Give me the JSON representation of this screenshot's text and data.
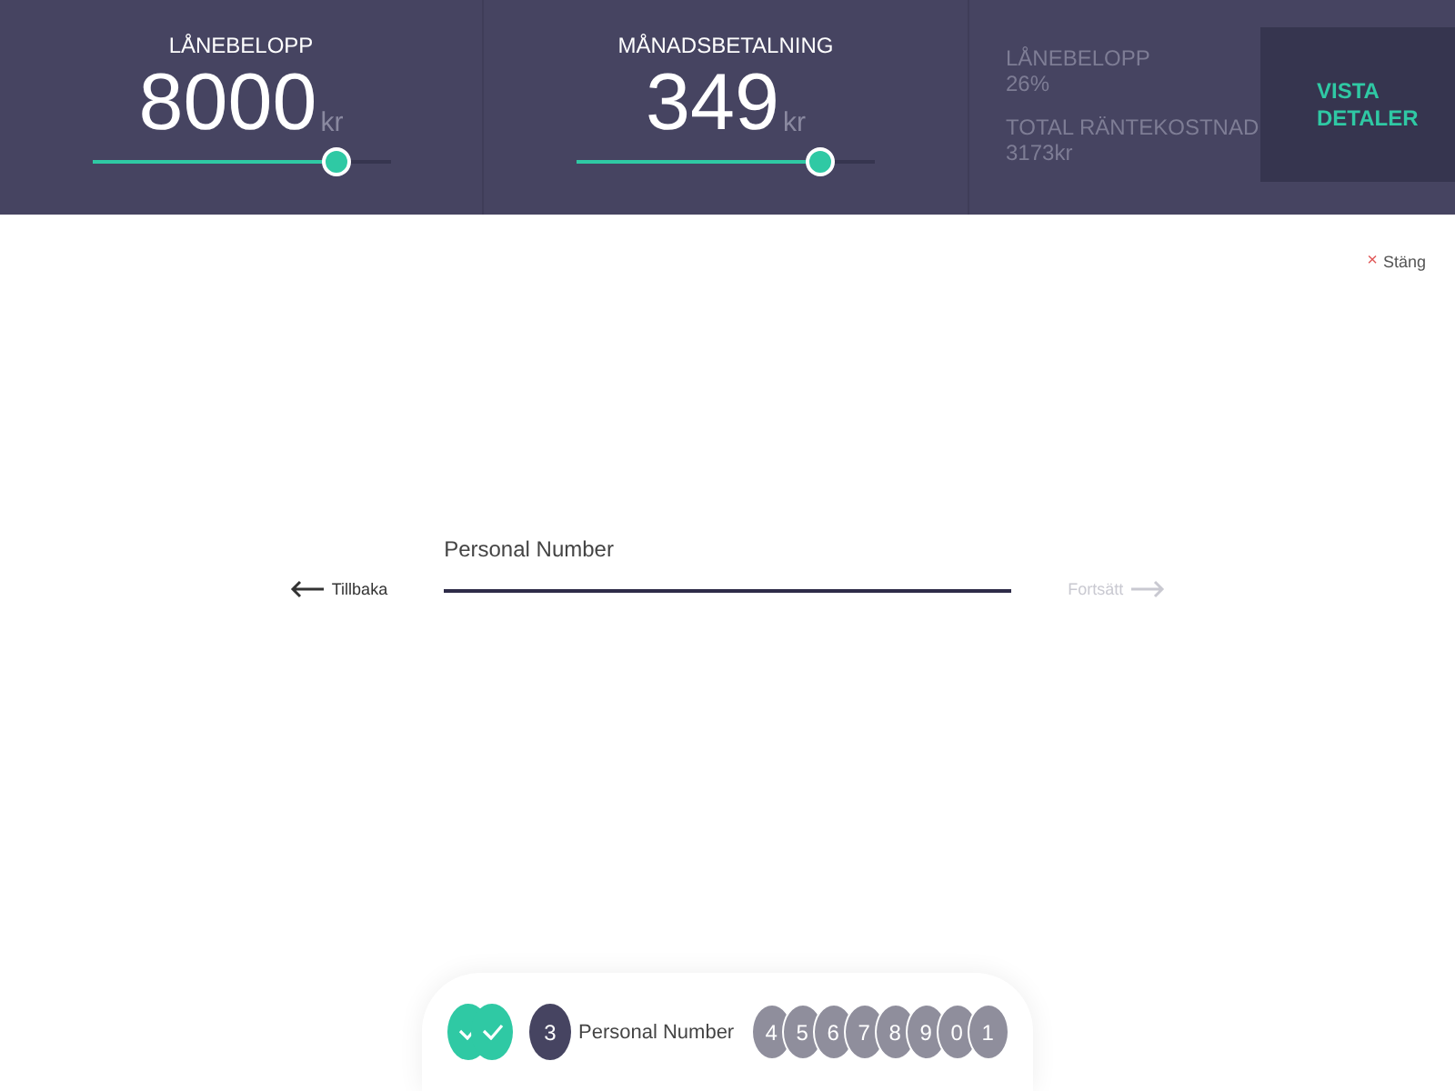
{
  "header": {
    "sliders": [
      {
        "label": "LÅNEBELOPP",
        "value": "8000",
        "unit": "kr",
        "level": 0.82
      },
      {
        "label": "MÅNADSBETALNING",
        "value": "349",
        "unit": "kr",
        "level": 0.82
      }
    ],
    "stats": [
      {
        "label": "LÅNEBELOPP",
        "value": "26%"
      },
      {
        "label": "TOTAL RÄNTEKOSTNAD",
        "value": "3173kr"
      }
    ],
    "details_button": "VISTA DETALER"
  },
  "close": {
    "icon": "×",
    "label": "Stäng"
  },
  "form": {
    "back": "Tillbaka",
    "field_label": "Personal Number",
    "next": "Fortsätt",
    "next_disabled": true
  },
  "steps": [
    {
      "kind": "done"
    },
    {
      "kind": "done"
    },
    {
      "kind": "current",
      "number": "3",
      "label": "Personal Number"
    },
    {
      "kind": "upcoming",
      "number": "4"
    },
    {
      "kind": "upcoming",
      "number": "5"
    },
    {
      "kind": "upcoming",
      "number": "6"
    },
    {
      "kind": "upcoming",
      "number": "7"
    },
    {
      "kind": "upcoming",
      "number": "8"
    },
    {
      "kind": "upcoming",
      "number": "9"
    },
    {
      "kind": "upcoming",
      "number": "0"
    },
    {
      "kind": "upcoming",
      "number": "1"
    }
  ]
}
